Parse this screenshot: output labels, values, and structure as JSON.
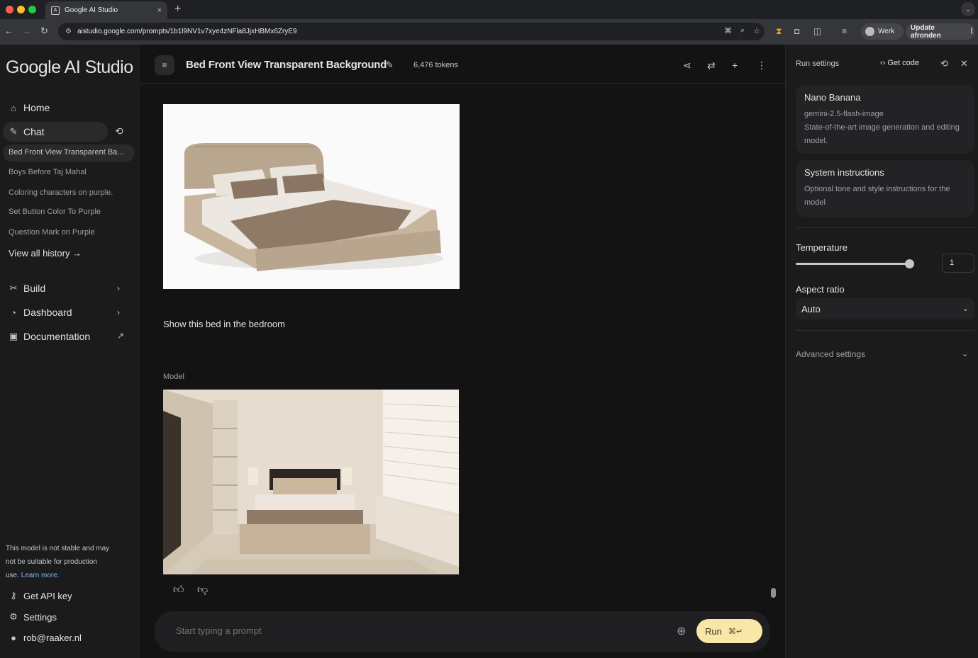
{
  "browser": {
    "tab_title": "Google AI Studio",
    "tab_close": "×",
    "new_tab": "+",
    "url": "aistudio.google.com/prompts/1b1l9NV1v7xye4zNFla8JjxHBMx6ZryE9",
    "profile_label": "Werk",
    "update_label": "Update afronden"
  },
  "sidebar": {
    "logo": "Google AI Studio",
    "home": "Home",
    "chat": "Chat",
    "history": [
      "Bed Front View Transparent Ba...",
      "Boys Before Taj Mahal",
      "Coloring characters on purple.",
      "Set Button Color To Purple",
      "Question Mark on Purple"
    ],
    "view_all": "View all history →",
    "build": "Build",
    "dashboard": "Dashboard",
    "documentation": "Documentation",
    "disclaimer": "This model is not stable and may not be suitable for production use.",
    "learn_more": "Learn more.",
    "get_api_key": "Get API key",
    "settings": "Settings",
    "user": "rob@raaker.nl"
  },
  "header": {
    "title": "Bed Front View Transparent Background",
    "tokens": "6,476 tokens"
  },
  "chat": {
    "user_message": "Show this bed in the bedroom",
    "model_label": "Model",
    "prompt_placeholder": "Start typing a prompt",
    "run_label": "Run",
    "run_shortcut": "⌘↵"
  },
  "run_settings": {
    "title": "Run settings",
    "get_code": "Get code",
    "model_name": "Nano Banana",
    "model_id": "gemini-2.5-flash-image",
    "model_desc": "State-of-the-art image generation and editing model.",
    "system_title": "System instructions",
    "system_desc": "Optional tone and style instructions for the model",
    "temperature_label": "Temperature",
    "temperature_value": "1",
    "aspect_label": "Aspect ratio",
    "aspect_value": "Auto",
    "advanced": "Advanced settings"
  },
  "colors": {
    "background": "#131314",
    "sidebar": "#1b1b1c",
    "run_button": "#f9e7a7",
    "link": "#8ab4f8"
  }
}
